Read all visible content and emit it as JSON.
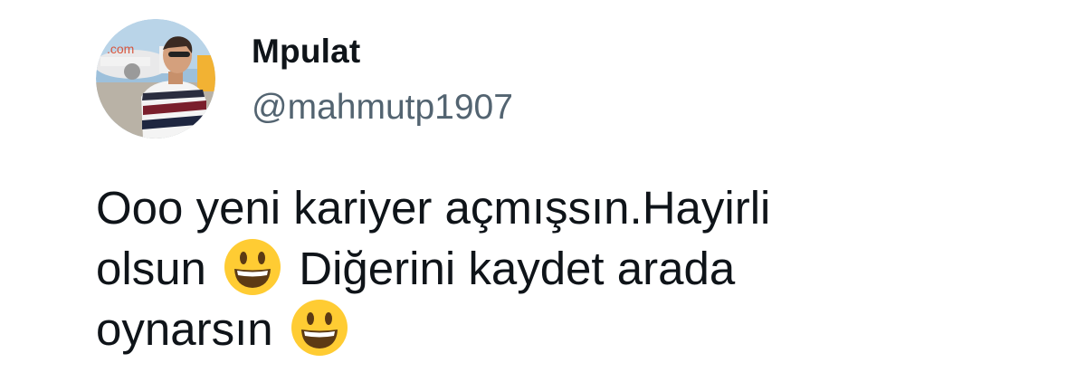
{
  "user": {
    "display_name": "Mpulat",
    "handle": "@mahmutp1907"
  },
  "tweet": {
    "line1": "Ooo yeni kariyer açmışsın.Hayirli",
    "line2_a": "olsun",
    "line2_b": "Diğerini kaydet arada",
    "line3": "oynarsın",
    "emoji_name": "grinning-face-icon"
  },
  "colors": {
    "text": "#0f1419",
    "handle": "#536471",
    "emoji_face": "#ffcc33"
  }
}
